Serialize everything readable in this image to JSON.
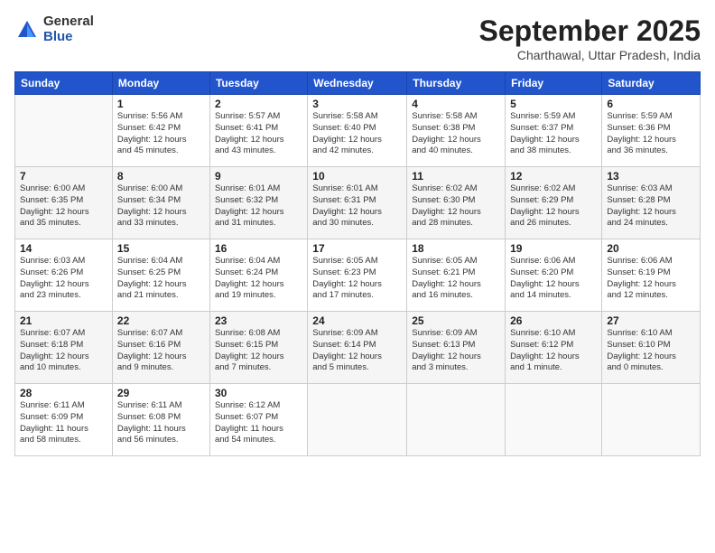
{
  "logo": {
    "general": "General",
    "blue": "Blue"
  },
  "title": "September 2025",
  "location": "Charthawal, Uttar Pradesh, India",
  "days_of_week": [
    "Sunday",
    "Monday",
    "Tuesday",
    "Wednesday",
    "Thursday",
    "Friday",
    "Saturday"
  ],
  "weeks": [
    [
      {
        "day": "",
        "detail": ""
      },
      {
        "day": "1",
        "detail": "Sunrise: 5:56 AM\nSunset: 6:42 PM\nDaylight: 12 hours\nand 45 minutes."
      },
      {
        "day": "2",
        "detail": "Sunrise: 5:57 AM\nSunset: 6:41 PM\nDaylight: 12 hours\nand 43 minutes."
      },
      {
        "day": "3",
        "detail": "Sunrise: 5:58 AM\nSunset: 6:40 PM\nDaylight: 12 hours\nand 42 minutes."
      },
      {
        "day": "4",
        "detail": "Sunrise: 5:58 AM\nSunset: 6:38 PM\nDaylight: 12 hours\nand 40 minutes."
      },
      {
        "day": "5",
        "detail": "Sunrise: 5:59 AM\nSunset: 6:37 PM\nDaylight: 12 hours\nand 38 minutes."
      },
      {
        "day": "6",
        "detail": "Sunrise: 5:59 AM\nSunset: 6:36 PM\nDaylight: 12 hours\nand 36 minutes."
      }
    ],
    [
      {
        "day": "7",
        "detail": "Sunrise: 6:00 AM\nSunset: 6:35 PM\nDaylight: 12 hours\nand 35 minutes."
      },
      {
        "day": "8",
        "detail": "Sunrise: 6:00 AM\nSunset: 6:34 PM\nDaylight: 12 hours\nand 33 minutes."
      },
      {
        "day": "9",
        "detail": "Sunrise: 6:01 AM\nSunset: 6:32 PM\nDaylight: 12 hours\nand 31 minutes."
      },
      {
        "day": "10",
        "detail": "Sunrise: 6:01 AM\nSunset: 6:31 PM\nDaylight: 12 hours\nand 30 minutes."
      },
      {
        "day": "11",
        "detail": "Sunrise: 6:02 AM\nSunset: 6:30 PM\nDaylight: 12 hours\nand 28 minutes."
      },
      {
        "day": "12",
        "detail": "Sunrise: 6:02 AM\nSunset: 6:29 PM\nDaylight: 12 hours\nand 26 minutes."
      },
      {
        "day": "13",
        "detail": "Sunrise: 6:03 AM\nSunset: 6:28 PM\nDaylight: 12 hours\nand 24 minutes."
      }
    ],
    [
      {
        "day": "14",
        "detail": "Sunrise: 6:03 AM\nSunset: 6:26 PM\nDaylight: 12 hours\nand 23 minutes."
      },
      {
        "day": "15",
        "detail": "Sunrise: 6:04 AM\nSunset: 6:25 PM\nDaylight: 12 hours\nand 21 minutes."
      },
      {
        "day": "16",
        "detail": "Sunrise: 6:04 AM\nSunset: 6:24 PM\nDaylight: 12 hours\nand 19 minutes."
      },
      {
        "day": "17",
        "detail": "Sunrise: 6:05 AM\nSunset: 6:23 PM\nDaylight: 12 hours\nand 17 minutes."
      },
      {
        "day": "18",
        "detail": "Sunrise: 6:05 AM\nSunset: 6:21 PM\nDaylight: 12 hours\nand 16 minutes."
      },
      {
        "day": "19",
        "detail": "Sunrise: 6:06 AM\nSunset: 6:20 PM\nDaylight: 12 hours\nand 14 minutes."
      },
      {
        "day": "20",
        "detail": "Sunrise: 6:06 AM\nSunset: 6:19 PM\nDaylight: 12 hours\nand 12 minutes."
      }
    ],
    [
      {
        "day": "21",
        "detail": "Sunrise: 6:07 AM\nSunset: 6:18 PM\nDaylight: 12 hours\nand 10 minutes."
      },
      {
        "day": "22",
        "detail": "Sunrise: 6:07 AM\nSunset: 6:16 PM\nDaylight: 12 hours\nand 9 minutes."
      },
      {
        "day": "23",
        "detail": "Sunrise: 6:08 AM\nSunset: 6:15 PM\nDaylight: 12 hours\nand 7 minutes."
      },
      {
        "day": "24",
        "detail": "Sunrise: 6:09 AM\nSunset: 6:14 PM\nDaylight: 12 hours\nand 5 minutes."
      },
      {
        "day": "25",
        "detail": "Sunrise: 6:09 AM\nSunset: 6:13 PM\nDaylight: 12 hours\nand 3 minutes."
      },
      {
        "day": "26",
        "detail": "Sunrise: 6:10 AM\nSunset: 6:12 PM\nDaylight: 12 hours\nand 1 minute."
      },
      {
        "day": "27",
        "detail": "Sunrise: 6:10 AM\nSunset: 6:10 PM\nDaylight: 12 hours\nand 0 minutes."
      }
    ],
    [
      {
        "day": "28",
        "detail": "Sunrise: 6:11 AM\nSunset: 6:09 PM\nDaylight: 11 hours\nand 58 minutes."
      },
      {
        "day": "29",
        "detail": "Sunrise: 6:11 AM\nSunset: 6:08 PM\nDaylight: 11 hours\nand 56 minutes."
      },
      {
        "day": "30",
        "detail": "Sunrise: 6:12 AM\nSunset: 6:07 PM\nDaylight: 11 hours\nand 54 minutes."
      },
      {
        "day": "",
        "detail": ""
      },
      {
        "day": "",
        "detail": ""
      },
      {
        "day": "",
        "detail": ""
      },
      {
        "day": "",
        "detail": ""
      }
    ]
  ]
}
